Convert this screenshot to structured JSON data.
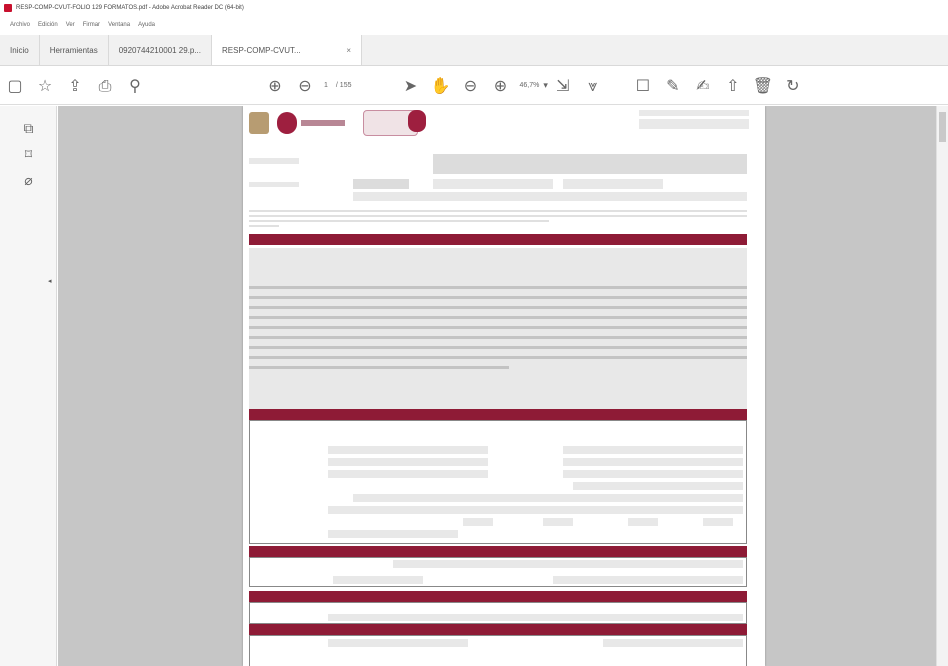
{
  "window": {
    "title": "RESP-COMP-CVUT-FOLIO 129 FORMATOS.pdf - Adobe Acrobat Reader DC (64-bit)"
  },
  "menu": {
    "items": [
      "Archivo",
      "Edición",
      "Ver",
      "Firmar",
      "Ventana",
      "Ayuda"
    ]
  },
  "tabs": [
    {
      "label": "Inicio"
    },
    {
      "label": "Herramientas"
    },
    {
      "label": "0920744210001 29.p..."
    },
    {
      "label": "RESP-COMP-CVUT..."
    }
  ],
  "toolbar": {
    "page_current": "1",
    "page_total": "/ 155",
    "zoom": "46,7%",
    "icons": {
      "thumbnails": "page-icon",
      "bookmark": "star-icon",
      "upload": "upload-icon",
      "print": "print-icon",
      "search": "search-icon",
      "prev": "arrow-up-icon",
      "next": "arrow-down-icon",
      "select": "pointer-icon",
      "hand": "hand-icon",
      "zoom_out": "zoom-out-icon",
      "zoom_in": "zoom-in-icon",
      "fit": "fit-page-icon",
      "scroll": "scroll-mode-icon",
      "comment": "comment-icon",
      "highlight": "pen-icon",
      "sign": "sign-icon",
      "share": "share-icon",
      "delete": "trash-icon",
      "rotate": "rotate-icon"
    },
    "accent_color": "#2a73c7"
  },
  "sidebar": {
    "icons": [
      "layers-icon",
      "bookmark-icon",
      "attachment-icon"
    ]
  },
  "document": {
    "banner_color": "#8e1b36",
    "field_color": "#e8e8e8"
  }
}
